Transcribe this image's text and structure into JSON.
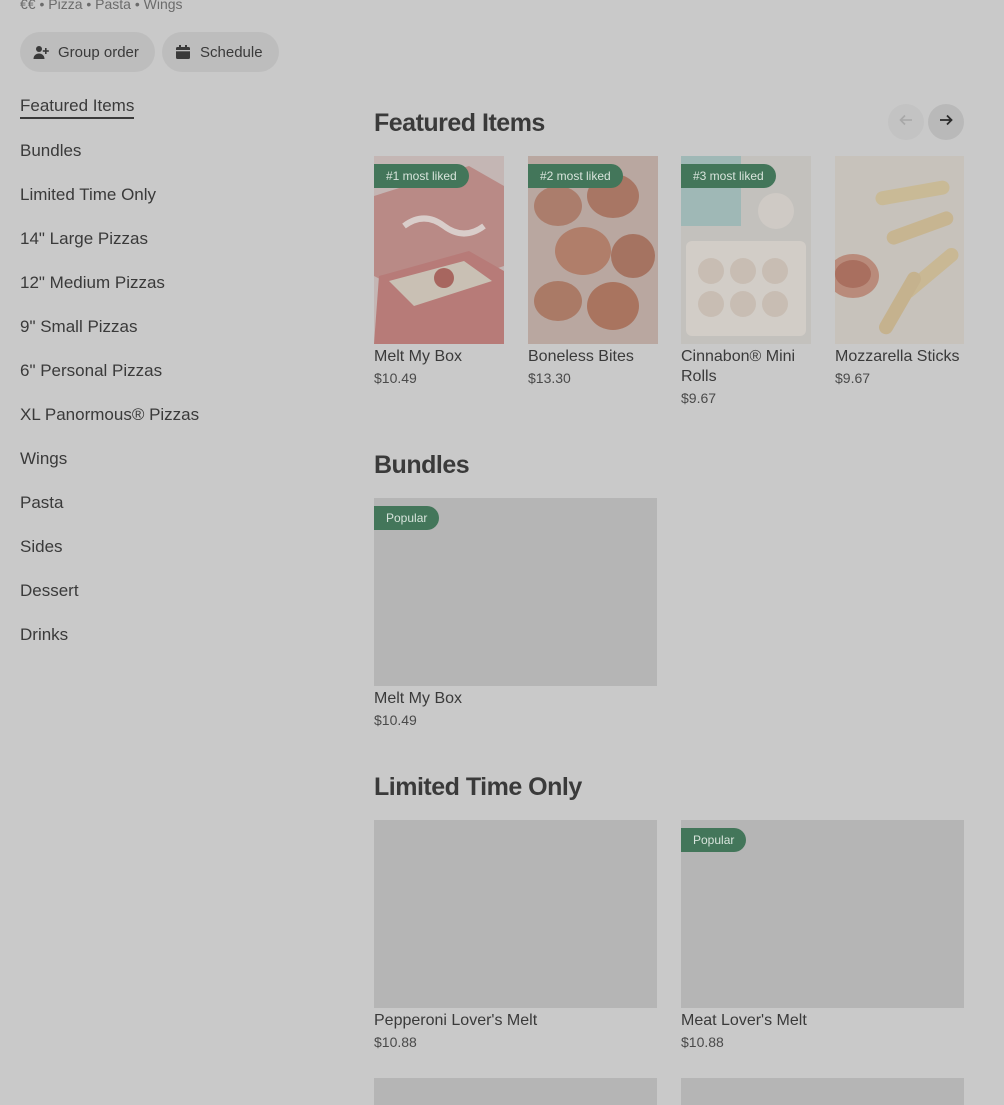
{
  "header": {
    "subline": "€€ • Pizza • Pasta • Wings",
    "group_order_label": "Group order",
    "schedule_label": "Schedule"
  },
  "nav": {
    "items": [
      {
        "label": "Featured Items"
      },
      {
        "label": "Bundles"
      },
      {
        "label": "Limited Time Only"
      },
      {
        "label": "14\" Large Pizzas"
      },
      {
        "label": "12\" Medium Pizzas"
      },
      {
        "label": "9\" Small Pizzas"
      },
      {
        "label": "6\" Personal Pizzas"
      },
      {
        "label": "XL Panormous® Pizzas"
      },
      {
        "label": "Wings"
      },
      {
        "label": "Pasta"
      },
      {
        "label": "Sides"
      },
      {
        "label": "Dessert"
      },
      {
        "label": "Drinks"
      }
    ]
  },
  "featured": {
    "title": "Featured Items",
    "prev_icon": "arrow-left-icon",
    "next_icon": "arrow-right-icon",
    "items": [
      {
        "badge": "#1 most liked",
        "name": "Melt My Box",
        "price": "$10.49"
      },
      {
        "badge": "#2 most liked",
        "name": "Boneless Bites",
        "price": "$13.30"
      },
      {
        "badge": "#3 most liked",
        "name": "Cinnabon® Mini Rolls",
        "price": "$9.67"
      },
      {
        "badge": "",
        "name": "Mozzarella Sticks",
        "price": "$9.67"
      }
    ]
  },
  "bundles": {
    "title": "Bundles",
    "items": [
      {
        "badge": "Popular",
        "name": "Melt My Box",
        "price": "$10.49"
      }
    ]
  },
  "limited": {
    "title": "Limited Time Only",
    "items": [
      {
        "badge": "",
        "name": "Pepperoni Lover's Melt",
        "price": "$10.88"
      },
      {
        "badge": "Popular",
        "name": "Meat Lover's Melt",
        "price": "$10.88"
      }
    ]
  },
  "colors": {
    "background": "#c9c9c9",
    "badge": "#43765a",
    "text": "#3a3a3a"
  }
}
